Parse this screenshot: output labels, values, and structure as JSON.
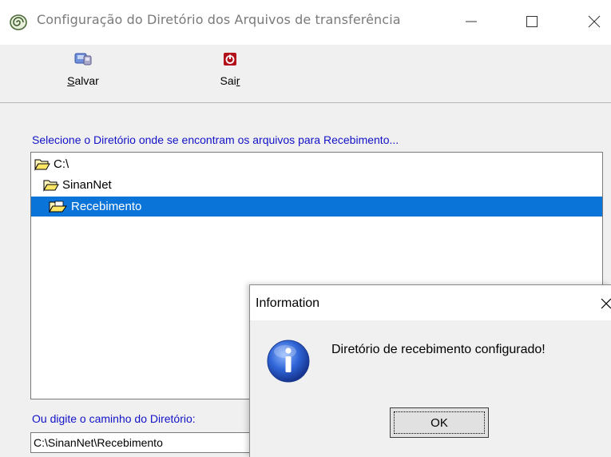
{
  "window": {
    "title": "Configuração do Diretório dos Arquivos de transferência",
    "icon": "spiral-app-icon"
  },
  "toolbar": {
    "save_label": "Salvar",
    "exit_label": "Sair"
  },
  "directory_prompt": "Selecione o Diretório onde se encontram os arquivos para Recebimento...",
  "tree": {
    "items": [
      {
        "label": "C:\\",
        "state": "open-folder"
      },
      {
        "label": "SinanNet",
        "state": "open-folder"
      },
      {
        "label": "Recebimento",
        "state": "selected"
      }
    ]
  },
  "path": {
    "label": "Ou digite o caminho do Diretório:",
    "value": "C:\\SinanNet\\Recebimento"
  },
  "dialog": {
    "title": "Information",
    "message": "Diretório de recebimento configurado!",
    "ok_label": "OK",
    "icon": "info-icon"
  },
  "colors": {
    "selection": "#0a74d9",
    "label_blue": "#1212c8",
    "panel": "#f0f0f0"
  }
}
